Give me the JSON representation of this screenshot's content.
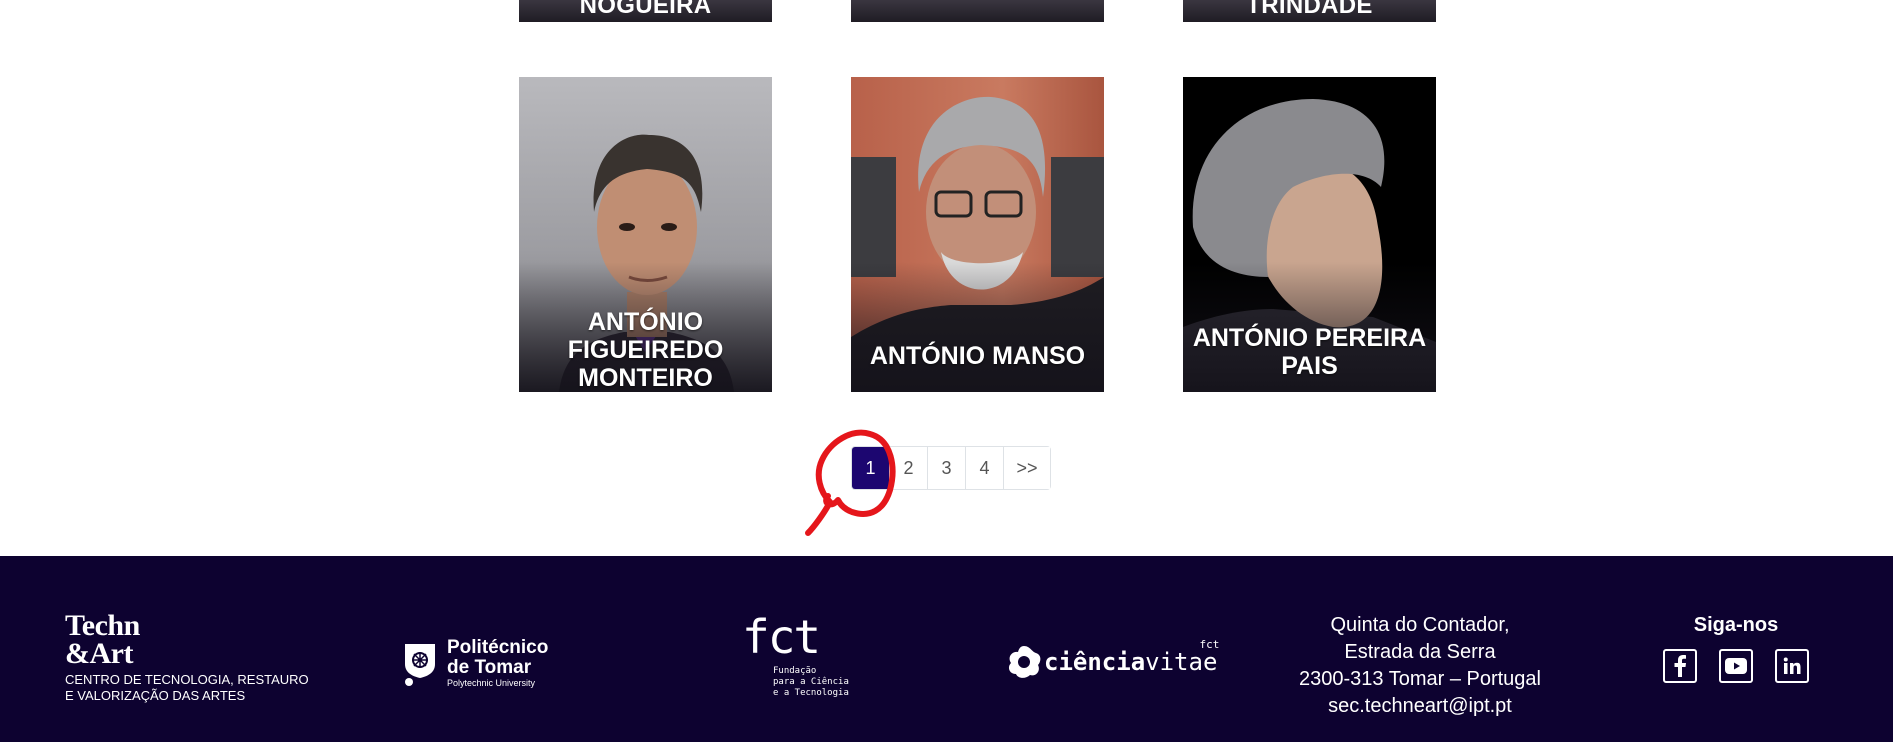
{
  "top_row": [
    {
      "name": "NOGUEIRA"
    },
    {
      "name": ""
    },
    {
      "name": "TRINDADE"
    }
  ],
  "team": [
    {
      "name": "ANTÓNIO FIGUEIREDO MONTEIRO"
    },
    {
      "name": "ANTÓNIO MANSO"
    },
    {
      "name": "ANTÓNIO PEREIRA PAIS"
    }
  ],
  "pagination": {
    "pages": [
      "1",
      "2",
      "3",
      "4"
    ],
    "next": ">>",
    "active": "1"
  },
  "footer": {
    "techn_art": {
      "line1": "Techn",
      "line2": "&Art",
      "sub1": "CENTRO DE TECNOLOGIA, RESTAURO",
      "sub2": "E VALORIZAÇÃO DAS ARTES"
    },
    "ipt": {
      "line1": "Politécnico",
      "line2": "de Tomar",
      "sub": "Polytechnic University"
    },
    "fct": {
      "big": "fct",
      "sub1": "Fundação",
      "sub2": "para a Ciência",
      "sub3": "e a Tecnologia"
    },
    "ciencia_vitae": {
      "bold": "ciência",
      "light": "vitae",
      "mini": "fct"
    },
    "address": {
      "line1": "Quinta do Contador,",
      "line2": "Estrada da Serra",
      "line3": "2300-313 Tomar – Portugal",
      "email": "sec.techneart@ipt.pt"
    },
    "social": {
      "title": "Siga-nos",
      "icons": [
        "facebook-icon",
        "youtube-icon",
        "linkedin-icon"
      ]
    }
  },
  "colors": {
    "footer_bg": "#0d0230",
    "active_page": "#1c0670",
    "annotation": "#e5161b"
  }
}
